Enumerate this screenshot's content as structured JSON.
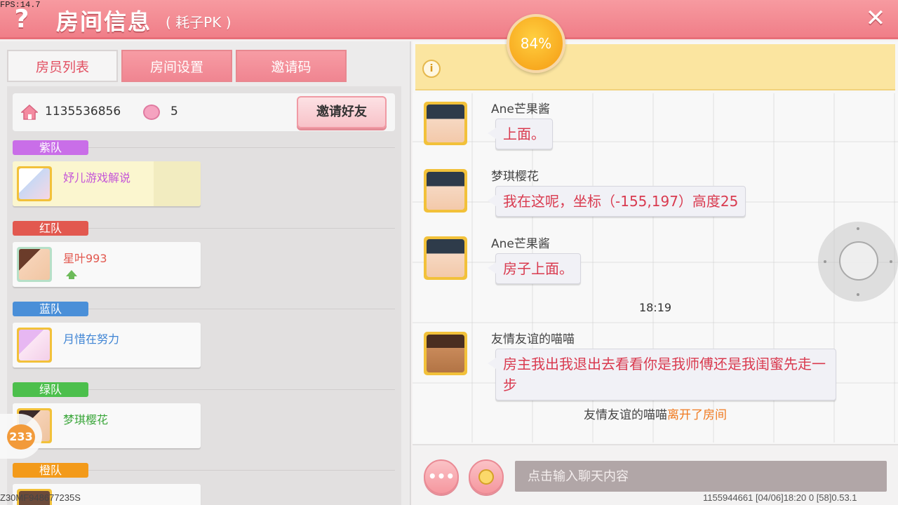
{
  "debug": {
    "fps": "FPS:14.7",
    "bottom_code": "Z30MF948677235S"
  },
  "header": {
    "help": "?",
    "title": "房间信息",
    "subtitle": "( 耗子PK )",
    "close": "✕",
    "progress": "84%"
  },
  "tabs": [
    {
      "label": "房员列表",
      "active": true
    },
    {
      "label": "房间设置",
      "active": false
    },
    {
      "label": "邀请码",
      "active": false
    }
  ],
  "room_info": {
    "room_id": "1135536856",
    "player_count": "5",
    "invite_button": "邀请好友"
  },
  "teams": [
    {
      "name": "紫队",
      "color": "#c96ee8",
      "members": [
        {
          "name": "妤儿游戏解说",
          "name_color": "#c455d8"
        }
      ]
    },
    {
      "name": "红队",
      "color": "#e2584f",
      "members": [
        {
          "name": "星叶993",
          "name_color": "#e2584f"
        }
      ]
    },
    {
      "name": "蓝队",
      "color": "#4a8fd8",
      "members": [
        {
          "name": "月惜在努力",
          "name_color": "#3e84d4"
        }
      ]
    },
    {
      "name": "绿队",
      "color": "#4cbf4c",
      "members": [
        {
          "name": "梦琪樱花",
          "name_color": "#3aa63a"
        }
      ]
    },
    {
      "name": "橙队",
      "color": "#f39a1a",
      "members": []
    }
  ],
  "side_badge": "233",
  "notice": {
    "icon": "i"
  },
  "chat": {
    "messages": [
      {
        "sender": "Ane芒果酱",
        "text": "上面。"
      },
      {
        "sender": "梦琪樱花",
        "text": "我在这呢，坐标（-155,197）高度25"
      },
      {
        "sender": "Ane芒果酱",
        "text": "房子上面。"
      },
      {
        "sender": "友情友谊的喵喵",
        "text": "房主我出我退出去看看你是我师傅还是我闺蜜先走一步"
      }
    ],
    "timestamp": "18:19",
    "system": {
      "user": "友情友谊的喵喵",
      "action": "离开了房间"
    },
    "input_placeholder": "点击输入聊天内容",
    "more_button": "•••"
  },
  "footer": {
    "info": "1155944661   [04/06]18:20 0   [58]0.53.1"
  }
}
